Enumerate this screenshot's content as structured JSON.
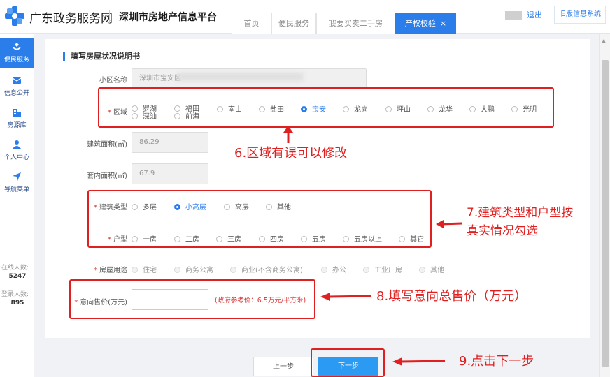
{
  "header": {
    "site_name": "广东政务服务网",
    "platform_name": "深圳市房地产信息平台",
    "tabs": [
      {
        "label": "首页"
      },
      {
        "label": "便民服务"
      },
      {
        "label": "我要买卖二手房"
      },
      {
        "label": "产权校验",
        "close": "×",
        "active": true
      }
    ],
    "logout": "退出",
    "old_system": "旧版信息系统"
  },
  "sidebar": {
    "items": [
      {
        "label": "便民服务",
        "icon": "service-icon",
        "active": true
      },
      {
        "label": "信息公开",
        "icon": "mail-icon"
      },
      {
        "label": "房源库",
        "icon": "house-library-icon"
      },
      {
        "label": "个人中心",
        "icon": "person-icon"
      },
      {
        "label": "导航菜单",
        "icon": "navigation-icon"
      }
    ],
    "online_label": "在线人数:",
    "online_value": "5247",
    "login_label": "登录人数:",
    "login_value": "895"
  },
  "form": {
    "section_title": "填写房屋状况说明书",
    "community": {
      "label": "小区名称",
      "value": "深圳市宝安区"
    },
    "district": {
      "label": "区域",
      "options": [
        "罗湖",
        "福田",
        "南山",
        "盐田",
        "宝安",
        "龙岗",
        "坪山",
        "龙华",
        "大鹏",
        "光明",
        "深汕",
        "前海"
      ],
      "selected": "宝安"
    },
    "building_area": {
      "label": "建筑面积(㎡)",
      "value": "86.29"
    },
    "inner_area": {
      "label": "套内面积(㎡)",
      "value": "67.9"
    },
    "building_type": {
      "label": "建筑类型",
      "options": [
        "多层",
        "小高层",
        "高层",
        "其他"
      ],
      "selected": "小高层"
    },
    "room_type": {
      "label": "户型",
      "options": [
        "一房",
        "二房",
        "三房",
        "四房",
        "五房",
        "五房以上",
        "其它"
      ],
      "selected": ""
    },
    "usage": {
      "label": "房屋用途",
      "options": [
        "住宅",
        "商务公寓",
        "商业(不含商务公寓)",
        "办公",
        "工业厂房",
        "其他"
      ],
      "selected": "住宅"
    },
    "price": {
      "label": "意向售价(万元)",
      "value": "",
      "hint": "(政府参考价：6.5万元/平方米)"
    },
    "prev_button": "上一步",
    "next_button": "下一步"
  },
  "annotations": {
    "note6": "6.区域有误可以修改",
    "note7_line1": "7.建筑类型和户型按",
    "note7_line2": "真实情况勾选",
    "note8": "8.填写意向总售价（万元）",
    "note9": "9.点击下一步",
    "color": "#e02020"
  },
  "colors": {
    "accent": "#2b7de9",
    "button": "#2b9af3",
    "required": "#e03030"
  }
}
